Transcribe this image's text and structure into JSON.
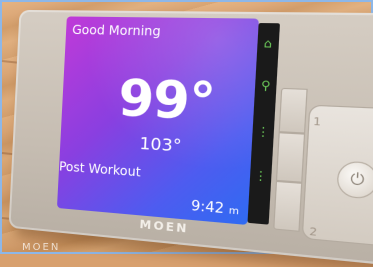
{
  "screen": {
    "greeting": "Good Morning",
    "temperature": "99°",
    "set_temperature": "103°",
    "mode": "Post Workout",
    "time": "9:42 ",
    "time_suffix": "m"
  },
  "device": {
    "brand": "MOEN",
    "button_label_1": "1",
    "button_label_2": "2",
    "knob_icon": "power-icon"
  },
  "watermark": "MOEN",
  "colors": {
    "screen_gradient_start": "#c03ad8",
    "screen_gradient_end": "#2f6bf2",
    "indicator_green": "#6fd15c",
    "hot_indicator": "#e24848",
    "cold_indicator": "#4a9be6"
  }
}
